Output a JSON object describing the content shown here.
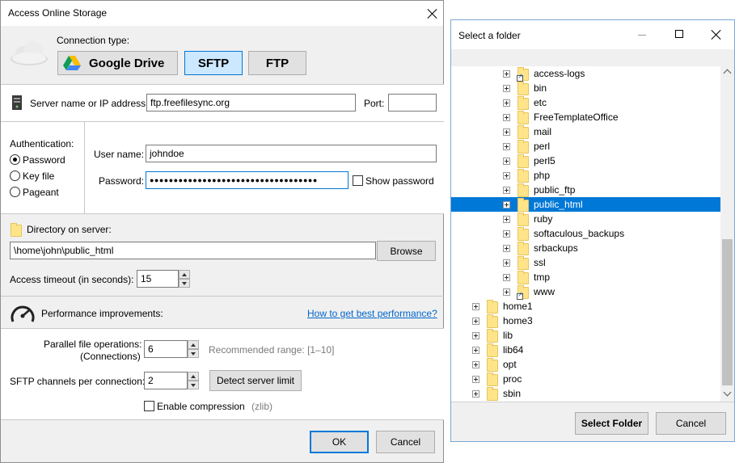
{
  "left_dialog": {
    "title": "Access Online Storage",
    "connection_type_label": "Connection type:",
    "conn_buttons": {
      "google": "Google Drive",
      "sftp": "SFTP",
      "ftp": "FTP"
    },
    "server_label": "Server name or IP address:",
    "server_value": "ftp.freefilesync.org",
    "port_label": "Port:",
    "port_value": "",
    "auth_label": "Authentication:",
    "auth_options": [
      "Password",
      "Key file",
      "Pageant"
    ],
    "auth_selected": "Password",
    "username_label": "User name:",
    "username_value": "johndoe",
    "password_label": "Password:",
    "password_value": "●●●●●●●●●●●●●●●●●●●●●●●●●●●●●●●●●●●",
    "show_password_label": "Show password",
    "dir_label": "Directory on server:",
    "dir_value": "\\home\\john\\public_html",
    "browse_label": "Browse",
    "timeout_label": "Access timeout (in seconds):",
    "timeout_value": "15",
    "perf_label": "Performance improvements:",
    "perf_link": "How to get best performance?",
    "parallel_label_1": "Parallel file operations:",
    "parallel_label_2": "(Connections)",
    "parallel_value": "6",
    "recommended": "Recommended range: [1–10]",
    "channels_label": "SFTP channels per connection:",
    "channels_value": "2",
    "detect_label": "Detect server limit",
    "compression_label": "Enable compression",
    "zlib": "(zlib)",
    "ok_label": "OK",
    "cancel_label": "Cancel"
  },
  "folder_dialog": {
    "title": "Select a folder",
    "tree_sub": [
      "access-logs",
      "bin",
      "etc",
      "FreeTemplateOffice",
      "mail",
      "perl",
      "perl5",
      "php",
      "public_ftp",
      "public_html",
      "ruby",
      "softaculous_backups",
      "srbackups",
      "ssl",
      "tmp",
      "www"
    ],
    "tree_root": [
      "home1",
      "home3",
      "lib",
      "lib64",
      "opt",
      "proc",
      "sbin"
    ],
    "selected": "public_html",
    "select_label": "Select Folder",
    "cancel_label": "Cancel"
  },
  "colors": {
    "accent": "#0078d7",
    "link": "#0066cc",
    "folder": "#ffe48a"
  }
}
